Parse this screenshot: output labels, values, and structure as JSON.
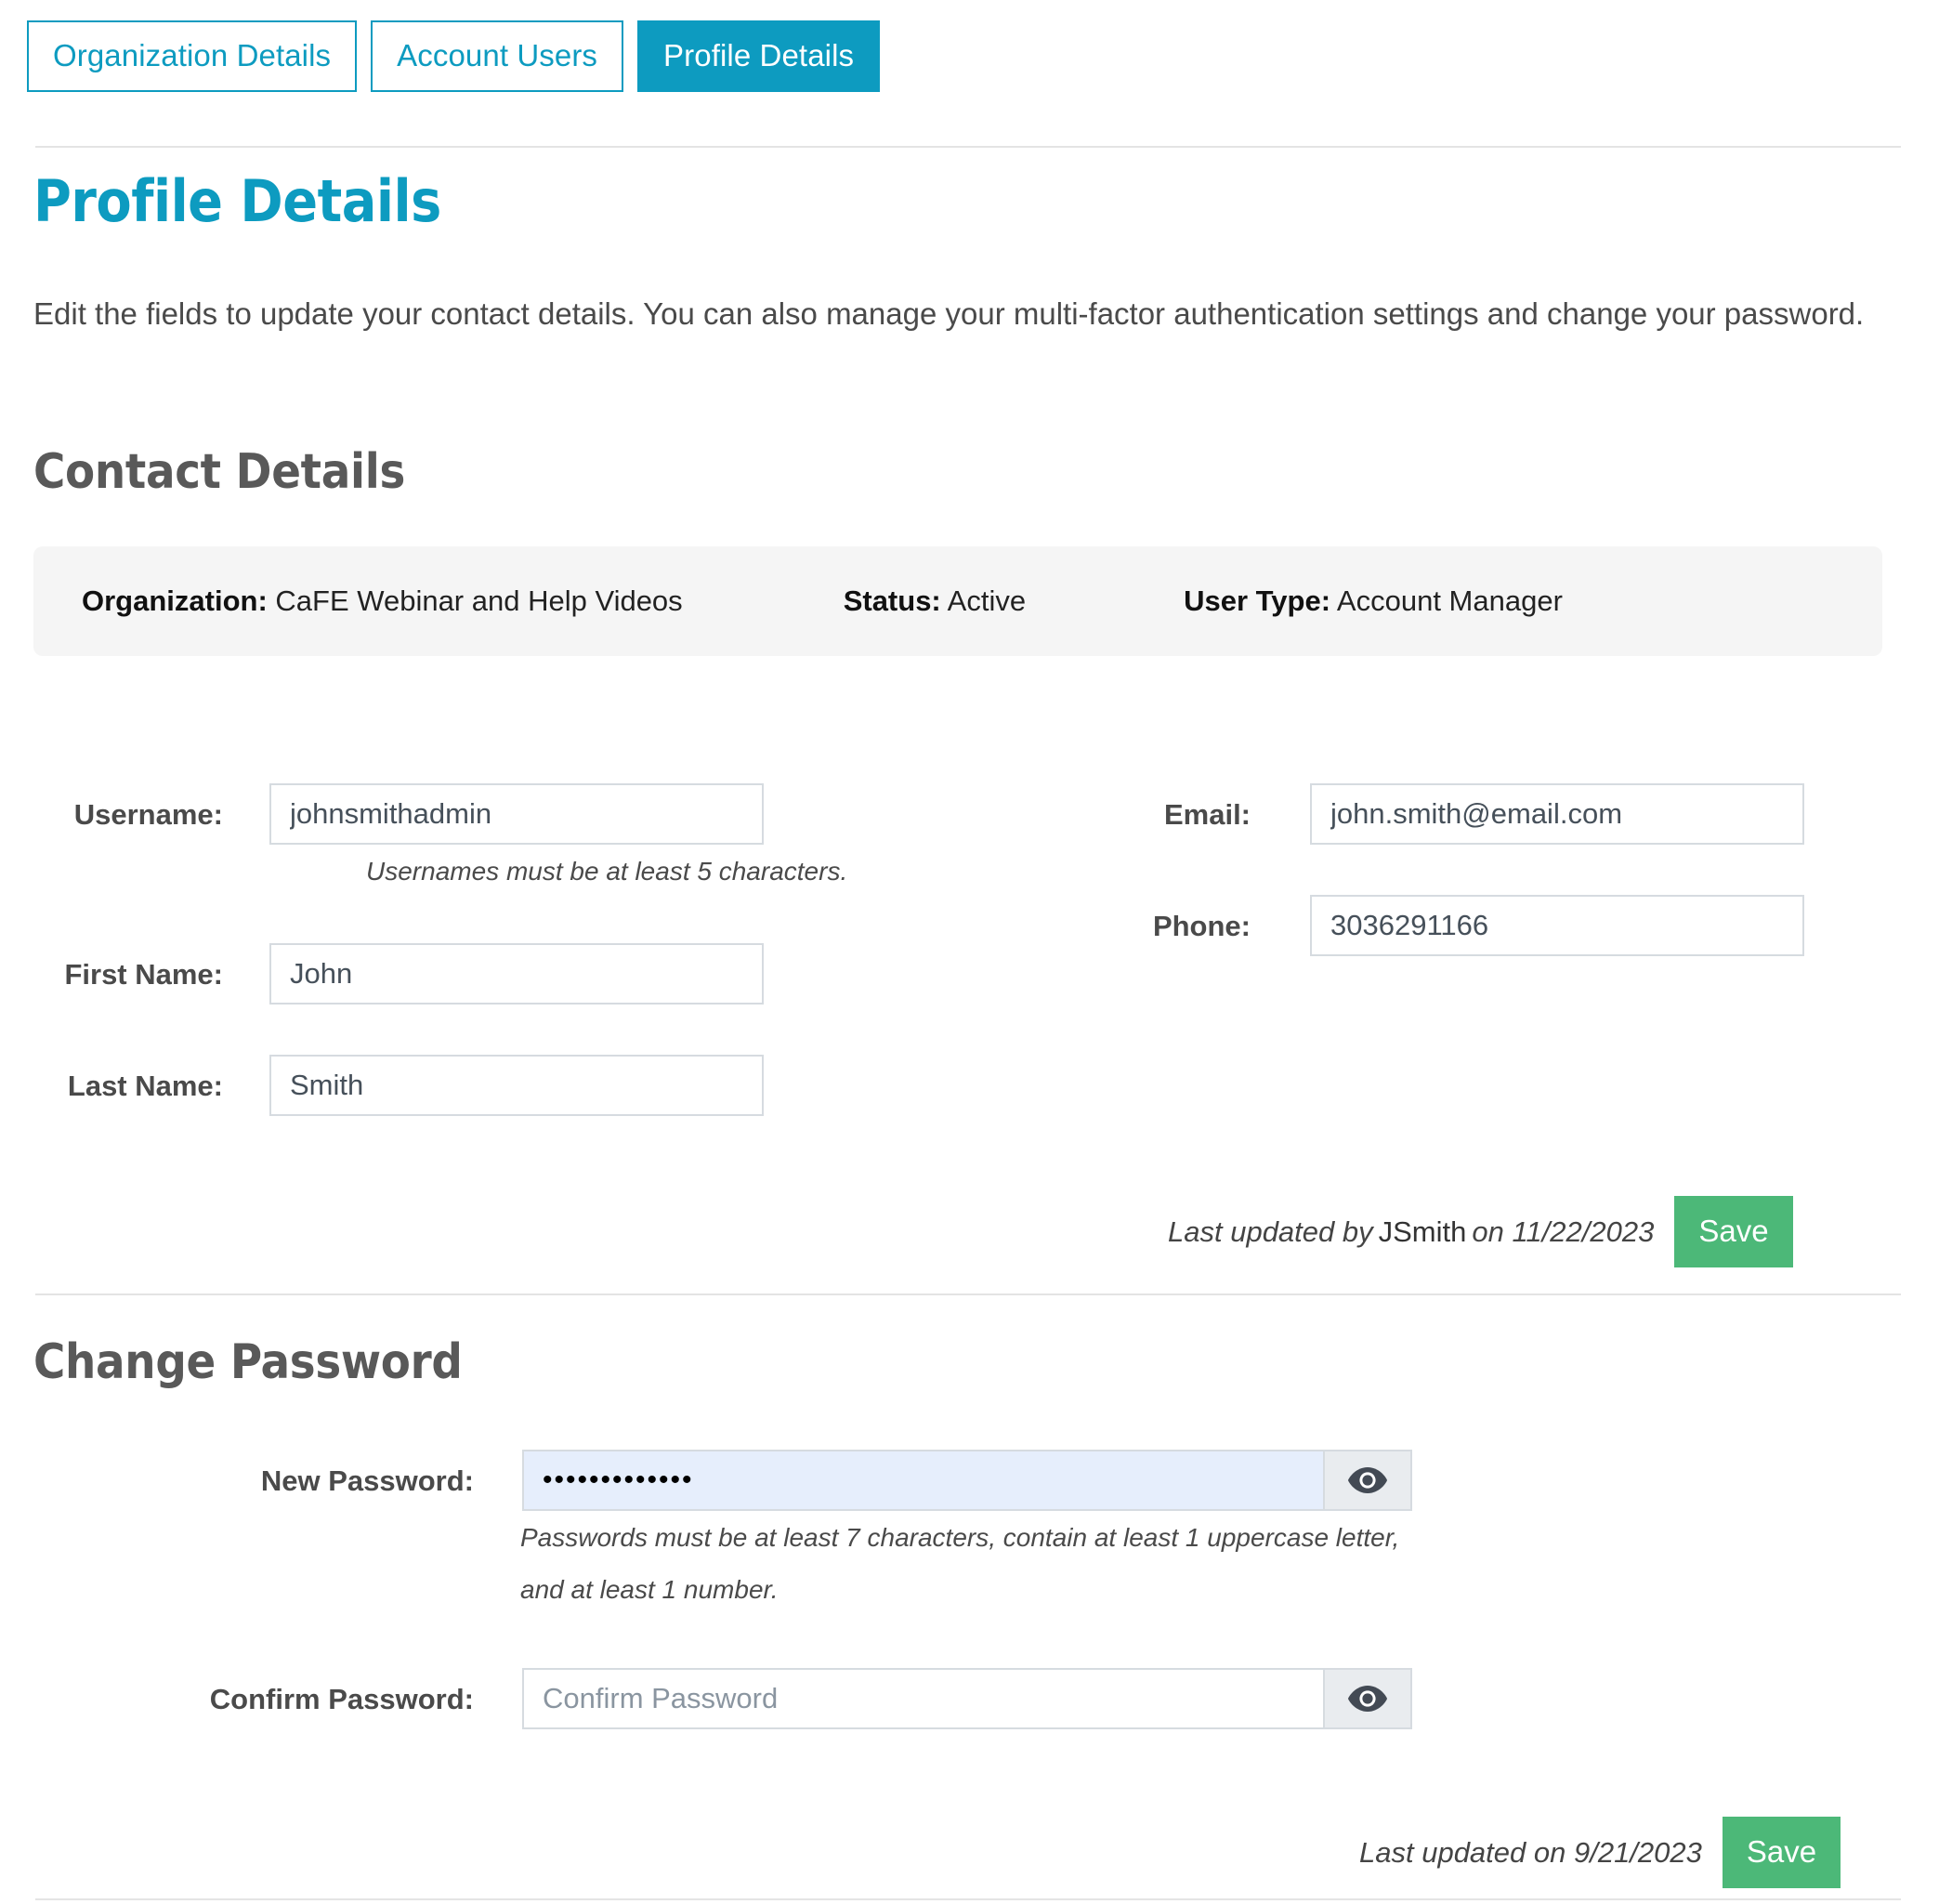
{
  "tabs": [
    {
      "label": "Organization Details",
      "active": false
    },
    {
      "label": "Account Users",
      "active": false
    },
    {
      "label": "Profile Details",
      "active": true
    }
  ],
  "page": {
    "title": "Profile Details",
    "description": "Edit the fields to update your contact details. You can also manage your multi-factor authentication settings and change your password."
  },
  "contact_section": {
    "heading": "Contact Details",
    "info_bar": {
      "organization_label": "Organization:",
      "organization_value": "CaFE Webinar and Help Videos",
      "status_label": "Status:",
      "status_value": "Active",
      "user_type_label": "User Type:",
      "user_type_value": "Account Manager"
    },
    "fields": {
      "username_label": "Username:",
      "username_value": "johnsmithadmin",
      "username_hint": "Usernames must be at least 5 characters.",
      "first_name_label": "First Name:",
      "first_name_value": "John",
      "last_name_label": "Last Name:",
      "last_name_value": "Smith",
      "email_label": "Email:",
      "email_value": "john.smith@email.com",
      "phone_label": "Phone:",
      "phone_value": "3036291166"
    },
    "footer": {
      "updated_prefix": "Last updated by",
      "updated_user": "JSmith",
      "updated_suffix": "on 11/22/2023",
      "save_label": "Save"
    }
  },
  "password_section": {
    "heading": "Change Password",
    "new_password_label": "New Password:",
    "new_password_value": "•••••••••••••",
    "new_password_hint": "Passwords must be at least 7 characters, contain at least 1 uppercase letter, and at least 1 number.",
    "confirm_password_label": "Confirm Password:",
    "confirm_password_value": "",
    "confirm_password_placeholder": "Confirm Password",
    "toggle_icon": "eye-icon",
    "footer": {
      "updated_text": "Last updated on 9/21/2023",
      "save_label": "Save"
    }
  },
  "colors": {
    "accent": "#0d9bc0",
    "save_green": "#4cb878",
    "info_bar_bg": "#f5f5f5",
    "autofill_bg": "#e6eefc",
    "divider": "#e4e4e4"
  }
}
